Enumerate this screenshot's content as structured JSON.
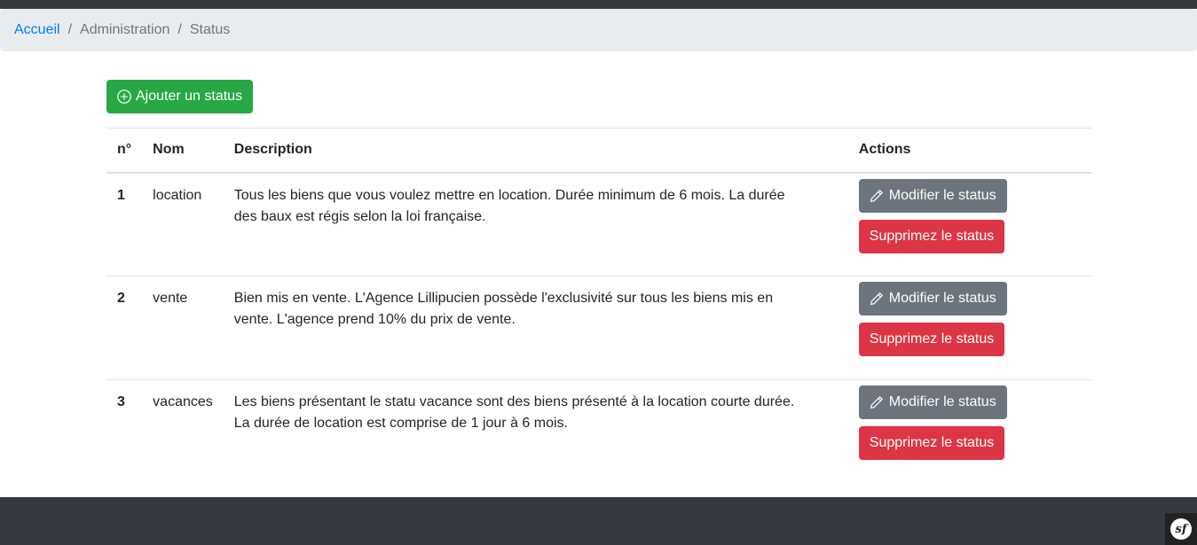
{
  "breadcrumb": {
    "items": [
      "Accueil",
      "Administration",
      "Status"
    ],
    "separator": "/"
  },
  "add_button": {
    "label": "Ajouter un status",
    "icon": "plus-circle-icon"
  },
  "table": {
    "headers": {
      "num": "n°",
      "name": "Nom",
      "description": "Description",
      "actions": "Actions"
    },
    "rows": [
      {
        "num": "1",
        "name": "location",
        "description": "Tous les biens que vous voulez mettre en location. Durée minimum de 6 mois. La durée des baux est régis selon la loi française.",
        "edit_label": "Modifier le status",
        "delete_label": "Supprimez le status"
      },
      {
        "num": "2",
        "name": "vente",
        "description": "Bien mis en vente. L'Agence Lillipucien possède l'exclusivité sur tous les biens mis en vente. L'agence prend 10% du prix de vente.",
        "edit_label": "Modifier le status",
        "delete_label": "Supprimez le status"
      },
      {
        "num": "3",
        "name": "vacances",
        "description": "Les biens présentant le statu vacance sont des biens présenté à la location courte durée. La durée de location est comprise de 1 jour à 6 mois.",
        "edit_label": "Modifier le status",
        "delete_label": "Supprimez le status"
      }
    ]
  },
  "toolbar": {
    "logo_text": "sf"
  },
  "colors": {
    "primary": "#007bff",
    "success": "#28a745",
    "secondary": "#6c757d",
    "danger": "#dc3545",
    "dark": "#343a40"
  }
}
